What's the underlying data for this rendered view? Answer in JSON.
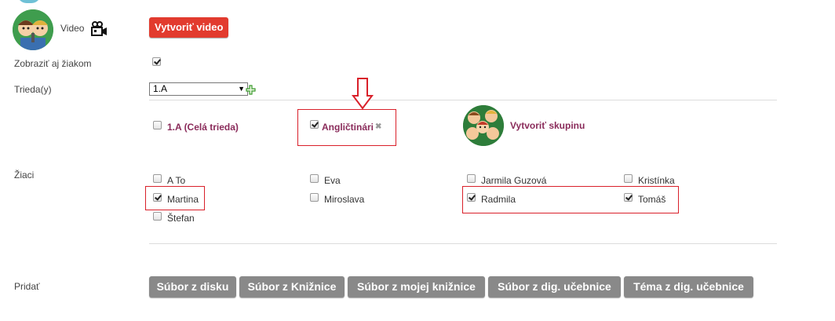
{
  "video": {
    "label": "Video",
    "create_button": "Vytvoriť video"
  },
  "show_to_students": {
    "label": "Zobraziť aj žiakom",
    "checked": true
  },
  "class": {
    "label": "Trieda(y)",
    "selected": "1.A"
  },
  "groups": {
    "items": [
      {
        "label": "1.A (Celá trieda)",
        "checked": false
      },
      {
        "label": "Angličtinári",
        "checked": true
      }
    ],
    "create_group": "Vytvoriť skupinu"
  },
  "students": {
    "label": "Žiaci",
    "items": [
      {
        "name": "A To",
        "checked": false
      },
      {
        "name": "Eva",
        "checked": false
      },
      {
        "name": "Jarmila Guzová",
        "checked": false
      },
      {
        "name": "Kristínka",
        "checked": false
      },
      {
        "name": "Martina",
        "checked": true
      },
      {
        "name": "Miroslava",
        "checked": false
      },
      {
        "name": "Radmila",
        "checked": true
      },
      {
        "name": "Tomáš",
        "checked": true
      },
      {
        "name": "Štefan",
        "checked": false
      }
    ]
  },
  "add": {
    "label": "Pridať",
    "buttons": [
      "Súbor z disku",
      "Súbor z Knižnice",
      "Súbor z mojej knižnice",
      "Súbor z dig. učebnice",
      "Téma z dig. učebnice"
    ]
  },
  "colors": {
    "primary_button": "#e23b2e",
    "secondary_button": "#898989",
    "group_link": "#8a2b5a",
    "highlight_box": "#d9202a"
  }
}
